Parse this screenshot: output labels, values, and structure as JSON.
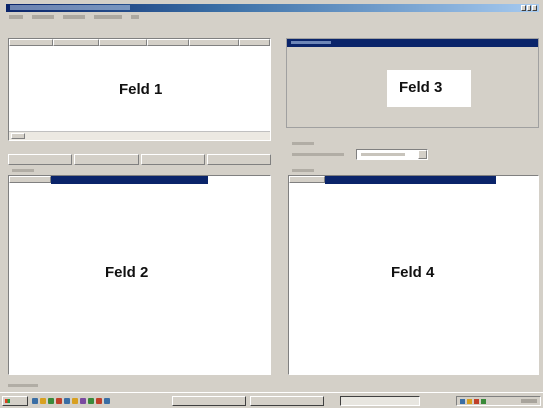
{
  "panels": {
    "feld1": "Feld 1",
    "feld2": "Feld 2",
    "feld3": "Feld 3",
    "feld4": "Feld 4"
  },
  "colors": {
    "selection": "#0a246a",
    "titlebar": "#0a246a",
    "surface": "#d4d0c8"
  },
  "icons": [
    "start-icon",
    "quick-launch-icon",
    "tray-clock-icon"
  ]
}
